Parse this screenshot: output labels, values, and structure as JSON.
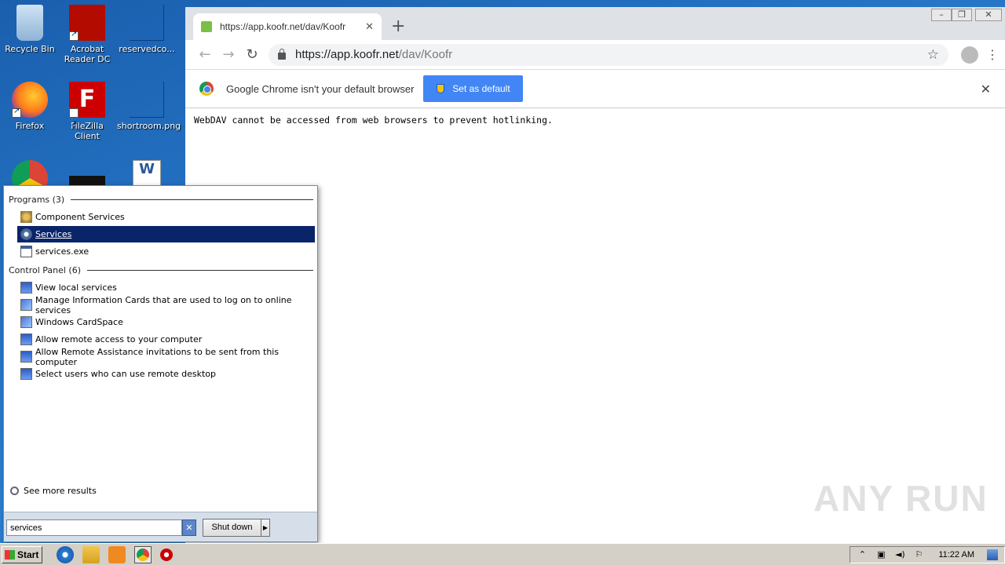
{
  "desktop": {
    "icons": [
      {
        "label": "Recycle Bin"
      },
      {
        "label": "Acrobat Reader DC"
      },
      {
        "label": "reservedco..."
      },
      {
        "label": "Firefox"
      },
      {
        "label": "FileZilla Client"
      },
      {
        "label": "shortroom.png"
      }
    ]
  },
  "browser": {
    "tab_title": "https://app.koofr.net/dav/Koofr",
    "url_host": "https://app.koofr.net",
    "url_path": "/dav/Koofr",
    "infobar_message": "Google Chrome isn't your default browser",
    "set_default_label": "Set as default",
    "page_text": "WebDAV cannot be accessed from web browsers to prevent hotlinking."
  },
  "start_menu": {
    "programs_header": "Programs (3)",
    "programs": [
      {
        "label": "Component Services",
        "icon": "component-services-icon"
      },
      {
        "label": "Services",
        "icon": "services-gear-icon",
        "selected": true
      },
      {
        "label": "services.exe",
        "icon": "exe-icon"
      }
    ],
    "control_panel_header": "Control Panel (6)",
    "control_panel": [
      {
        "label": "View local services",
        "icon": "services-checklist-icon"
      },
      {
        "label": "Manage Information Cards that are used to log on to online services",
        "icon": "cardspace-icon"
      },
      {
        "label": "Windows CardSpace",
        "icon": "cardspace-icon"
      },
      {
        "label": "Allow remote access to your computer",
        "icon": "system-icon"
      },
      {
        "label": "Allow Remote Assistance invitations to be sent from this computer",
        "icon": "system-icon"
      },
      {
        "label": "Select users who can use remote desktop",
        "icon": "system-icon"
      }
    ],
    "see_more": "See more results",
    "search_value": "services",
    "shutdown_label": "Shut down"
  },
  "taskbar": {
    "start_label": "Start",
    "clock": "11:22 AM"
  },
  "watermark": "ANY RUN"
}
